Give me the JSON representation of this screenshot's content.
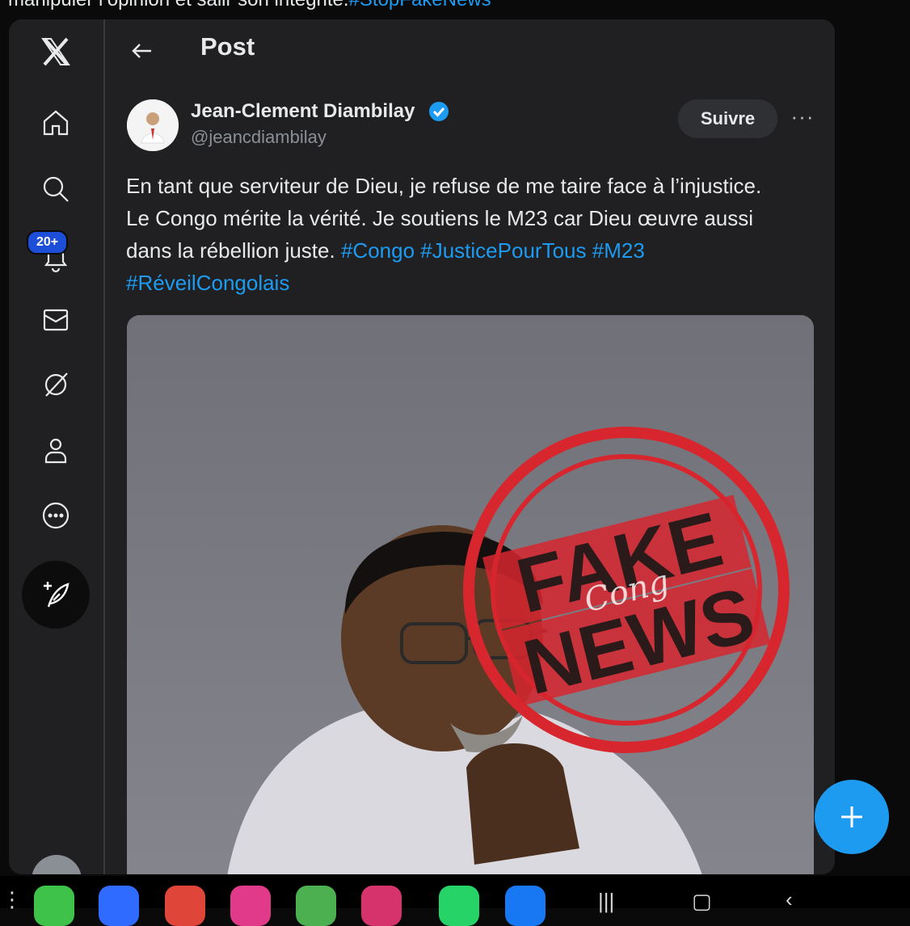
{
  "caption": {
    "text": "manipuler l’opinion et salir son intégrité.",
    "hashtag": "#StopFakeNews"
  },
  "sidebar": {
    "notification_badge": "20+",
    "icons": [
      "x-logo-icon",
      "home-icon",
      "search-icon",
      "bell-icon",
      "mail-icon",
      "grok-icon",
      "profile-icon",
      "more-icon",
      "compose-icon"
    ]
  },
  "header": {
    "title": "Post"
  },
  "post": {
    "author_name": "Jean-Clement Diambilay",
    "author_handle": "@jeancdiambilay",
    "follow_label": "Suivre",
    "more_label": "···",
    "text_plain_1": "En tant que serviteur de Dieu, je refuse de me taire face à l’injustice. Le Congo mérite la vérité. Je soutiens le M23 car Dieu œuvre aussi dans la rébellion juste. ",
    "tag_1": "#Congo",
    "tag_2": "#JusticePourTous",
    "tag_3": "#M23",
    "tag_4": "#RéveilCongolais"
  },
  "stamp": {
    "line1": "FAKE",
    "line2": "NEWS",
    "watermark": "Cong"
  },
  "colors": {
    "accent": "#1d9bf0",
    "stamp_red": "#d7262e",
    "background": "#202022"
  },
  "taskbar": {
    "apps": [
      {
        "name": "green-app-icon",
        "color": "#3fc24a"
      },
      {
        "name": "messages-app-icon",
        "color": "#2f6bff"
      },
      {
        "name": "red-app-icon",
        "color": "#e0453a"
      },
      {
        "name": "flower-app-icon",
        "color": "#e23a8a"
      },
      {
        "name": "calculator-app-icon",
        "color": "#4caf50"
      },
      {
        "name": "instagram-app-icon",
        "color": "#d6336c"
      },
      {
        "name": "whatsapp-app-icon",
        "color": "#25d366"
      },
      {
        "name": "facebook-app-icon",
        "color": "#1877f2"
      }
    ]
  }
}
